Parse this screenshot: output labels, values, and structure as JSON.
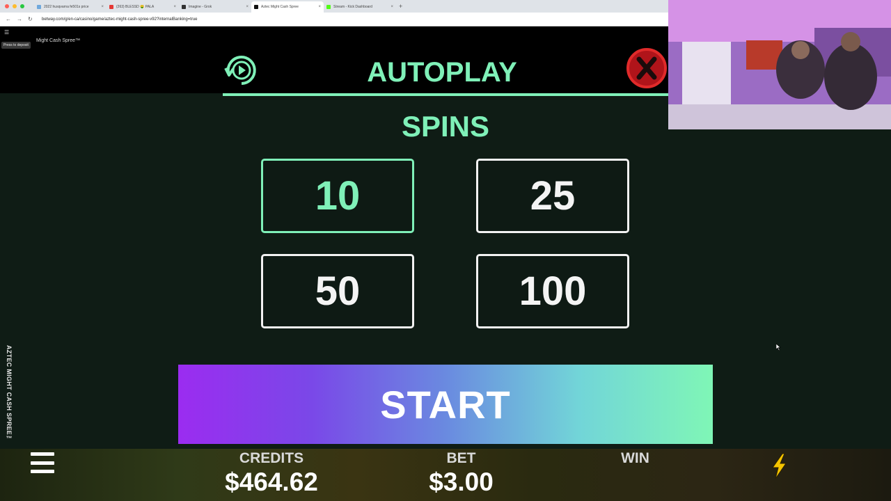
{
  "browser": {
    "tabs": [
      {
        "title": "2022 husqvarna fe501s price",
        "fav": "#6fa8dc",
        "active": false
      },
      {
        "title": "(263) BLESSD 🤑 PALA",
        "fav": "#e53935",
        "active": false
      },
      {
        "title": "Imagine - Grok",
        "fav": "#333333",
        "active": false
      },
      {
        "title": "Aztec Might Cash Spree",
        "fav": "#111111",
        "active": true
      },
      {
        "title": "Stream - Kick Dashboard",
        "fav": "#53fc18",
        "active": false
      }
    ],
    "url": "betway.com/g/en-ca/casino/game/aztec-might-cash-spree-v92?internalBanking=true"
  },
  "game": {
    "small_title": "Might Cash Spree™",
    "tooltip": "Press to deposit",
    "side_title": "AZTEC MIGHT CASH SPREE™"
  },
  "autoplay": {
    "title": "AUTOPLAY",
    "spins_label": "SPINS",
    "options": [
      "10",
      "25",
      "50",
      "100"
    ],
    "selected": "10",
    "start_label": "START",
    "accent_color": "#7ff0b8"
  },
  "bottom": {
    "credits_label": "CREDITS",
    "credits_value": "$464.62",
    "bet_label": "BET",
    "bet_value": "$3.00",
    "win_label": "WIN"
  },
  "icons": {
    "autoplay": "autoplay-cycle-icon",
    "close": "close-x-icon",
    "menu": "hamburger-menu-icon",
    "turbo": "lightning-bolt-icon"
  }
}
